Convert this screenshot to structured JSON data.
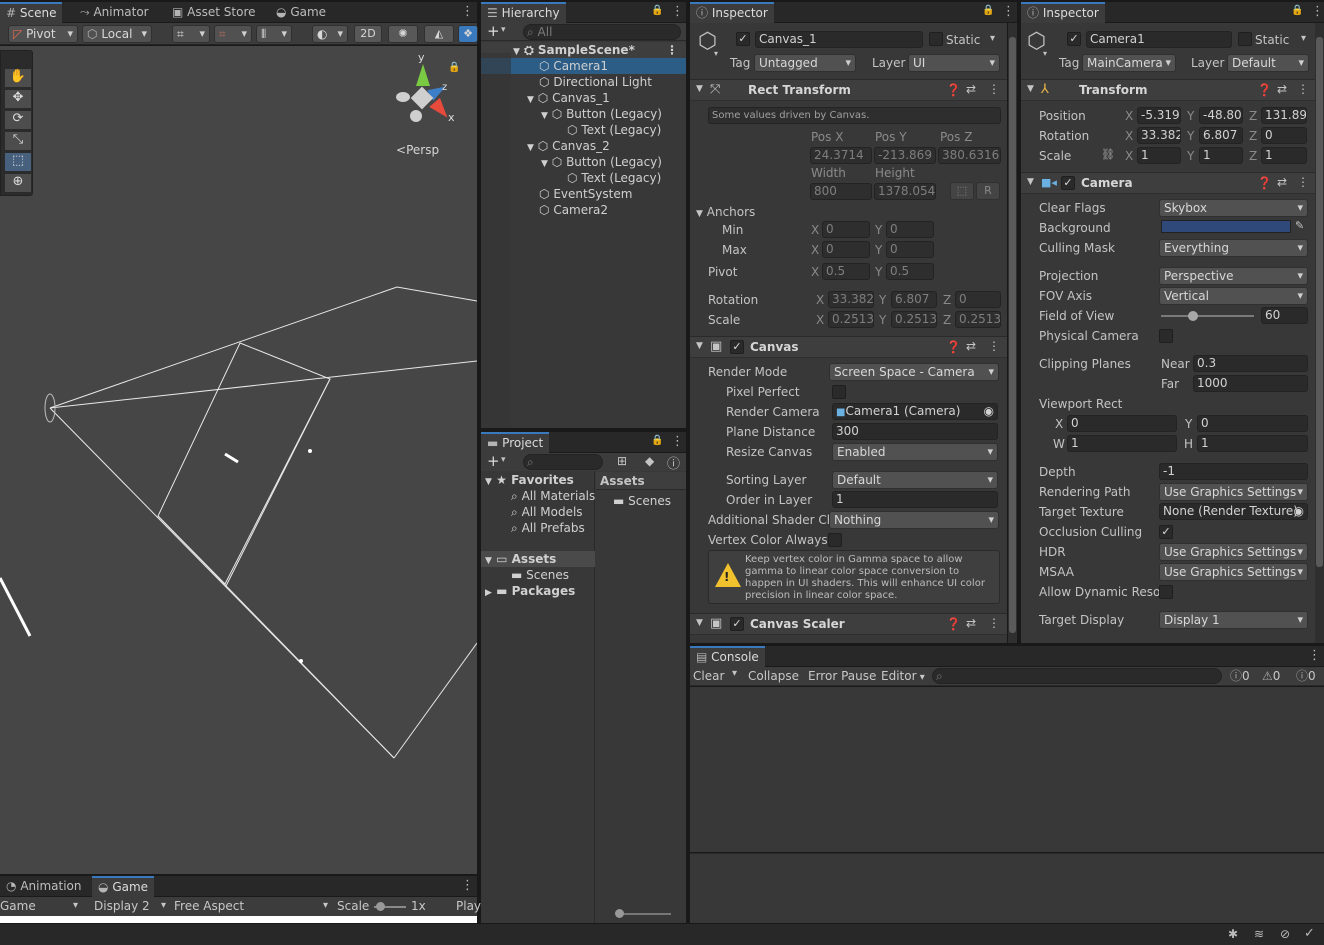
{
  "scene_window": {
    "tabs": [
      "Scene",
      "Animator",
      "Asset Store",
      "Game"
    ],
    "toolbar": {
      "pivot": "Pivot",
      "local": "Local",
      "mode_2d": "2D"
    },
    "gizmo": {
      "x": "x",
      "y": "y",
      "z": "z",
      "persp": "Persp"
    }
  },
  "game_window": {
    "tabs": [
      "Animation",
      "Game"
    ],
    "game_select": "Game",
    "display": "Display 2",
    "aspect": "Free Aspect",
    "scale_label": "Scale",
    "scale_value": "1x",
    "play": "Play"
  },
  "hierarchy": {
    "tab": "Hierarchy",
    "search_placeholder": "All",
    "scene": "SampleScene*",
    "items": [
      "Camera1",
      "Directional Light",
      "Canvas_1",
      "Button (Legacy)",
      "Text (Legacy)",
      "Canvas_2",
      "Button (Legacy)",
      "Text (Legacy)",
      "EventSystem",
      "Camera2"
    ]
  },
  "project": {
    "tab": "Project",
    "favorites": "Favorites",
    "fav_items": [
      "All Materials",
      "All Models",
      "All Prefabs"
    ],
    "assets": "Assets",
    "asset_children": [
      "Scenes"
    ],
    "packages": "Packages",
    "right_header": "Assets",
    "right_items": [
      "Scenes"
    ]
  },
  "inspector1": {
    "tab": "Inspector",
    "name": "Canvas_1",
    "static": "Static",
    "tag_label": "Tag",
    "tag": "Untagged",
    "layer_label": "Layer",
    "layer": "UI",
    "rect_transform": {
      "title": "Rect Transform",
      "note": "Some values driven by Canvas.",
      "posx_label": "Pos X",
      "posy_label": "Pos Y",
      "posz_label": "Pos Z",
      "posx": "24.3714",
      "posy": "-213.869",
      "posz": "380.6316",
      "width_label": "Width",
      "height_label": "Height",
      "width": "800",
      "height": "1378.054",
      "r_btn": "R",
      "anchors": "Anchors",
      "min": "Min",
      "max": "Max",
      "min_x": "0",
      "min_y": "0",
      "max_x": "0",
      "max_y": "0",
      "pivot": "Pivot",
      "pivot_x": "0.5",
      "pivot_y": "0.5",
      "rotation": "Rotation",
      "rot_x": "33.382",
      "rot_y": "6.807",
      "rot_z": "0",
      "scale": "Scale",
      "scale_x": "0.2513",
      "scale_y": "0.2513",
      "scale_z": "0.2513"
    },
    "canvas": {
      "title": "Canvas",
      "render_mode_label": "Render Mode",
      "render_mode": "Screen Space - Camera",
      "pixel_perfect": "Pixel Perfect",
      "render_camera_label": "Render Camera",
      "render_camera": "Camera1 (Camera)",
      "plane_distance_label": "Plane Distance",
      "plane_distance": "300",
      "resize_canvas_label": "Resize Canvas",
      "resize_canvas": "Enabled",
      "sorting_layer_label": "Sorting Layer",
      "sorting_layer": "Default",
      "order_label": "Order in Layer",
      "order": "1",
      "shader_label": "Additional Shader Ch",
      "shader": "Nothing",
      "vertex_label": "Vertex Color Always I",
      "warning": "Keep vertex color in Gamma space to allow gamma to linear color space conversion to happen in UI shaders. This will enhance UI color precision in linear color space."
    },
    "canvas_scaler": {
      "title": "Canvas Scaler"
    }
  },
  "inspector2": {
    "tab": "Inspector",
    "name": "Camera1",
    "static": "Static",
    "tag_label": "Tag",
    "tag": "MainCamera",
    "layer_label": "Layer",
    "layer": "Default",
    "transform": {
      "title": "Transform",
      "position": "Position",
      "pos_x": "-5.319",
      "pos_y": "-48.80",
      "pos_z": "131.89",
      "rotation": "Rotation",
      "rot_x": "33.382",
      "rot_y": "6.807",
      "rot_z": "0",
      "scale": "Scale",
      "scale_x": "1",
      "scale_y": "1",
      "scale_z": "1"
    },
    "camera": {
      "title": "Camera",
      "clear_flags_label": "Clear Flags",
      "clear_flags": "Skybox",
      "background_label": "Background",
      "background_color": "#2f4a7a",
      "culling_label": "Culling Mask",
      "culling": "Everything",
      "projection_label": "Projection",
      "projection": "Perspective",
      "fov_axis_label": "FOV Axis",
      "fov_axis": "Vertical",
      "fov_label": "Field of View",
      "fov": "60",
      "physical_label": "Physical Camera",
      "clipping_label": "Clipping Planes",
      "near_label": "Near",
      "near": "0.3",
      "far_label": "Far",
      "far": "1000",
      "viewport_label": "Viewport Rect",
      "vx": "0",
      "vy": "0",
      "vw": "1",
      "vh": "1",
      "depth_label": "Depth",
      "depth": "-1",
      "rendering_path_label": "Rendering Path",
      "rendering_path": "Use Graphics Settings",
      "target_texture_label": "Target Texture",
      "target_texture": "None (Render Texture)",
      "occlusion_label": "Occlusion Culling",
      "hdr_label": "HDR",
      "hdr": "Use Graphics Settings",
      "msaa_label": "MSAA",
      "msaa": "Use Graphics Settings",
      "dynamic_label": "Allow Dynamic Resol",
      "target_display_label": "Target Display",
      "target_display": "Display 1"
    }
  },
  "console": {
    "tab": "Console",
    "clear": "Clear",
    "collapse": "Collapse",
    "error_pause": "Error Pause",
    "editor": "Editor",
    "count_log": "0",
    "count_warn": "0",
    "count_err": "0"
  }
}
